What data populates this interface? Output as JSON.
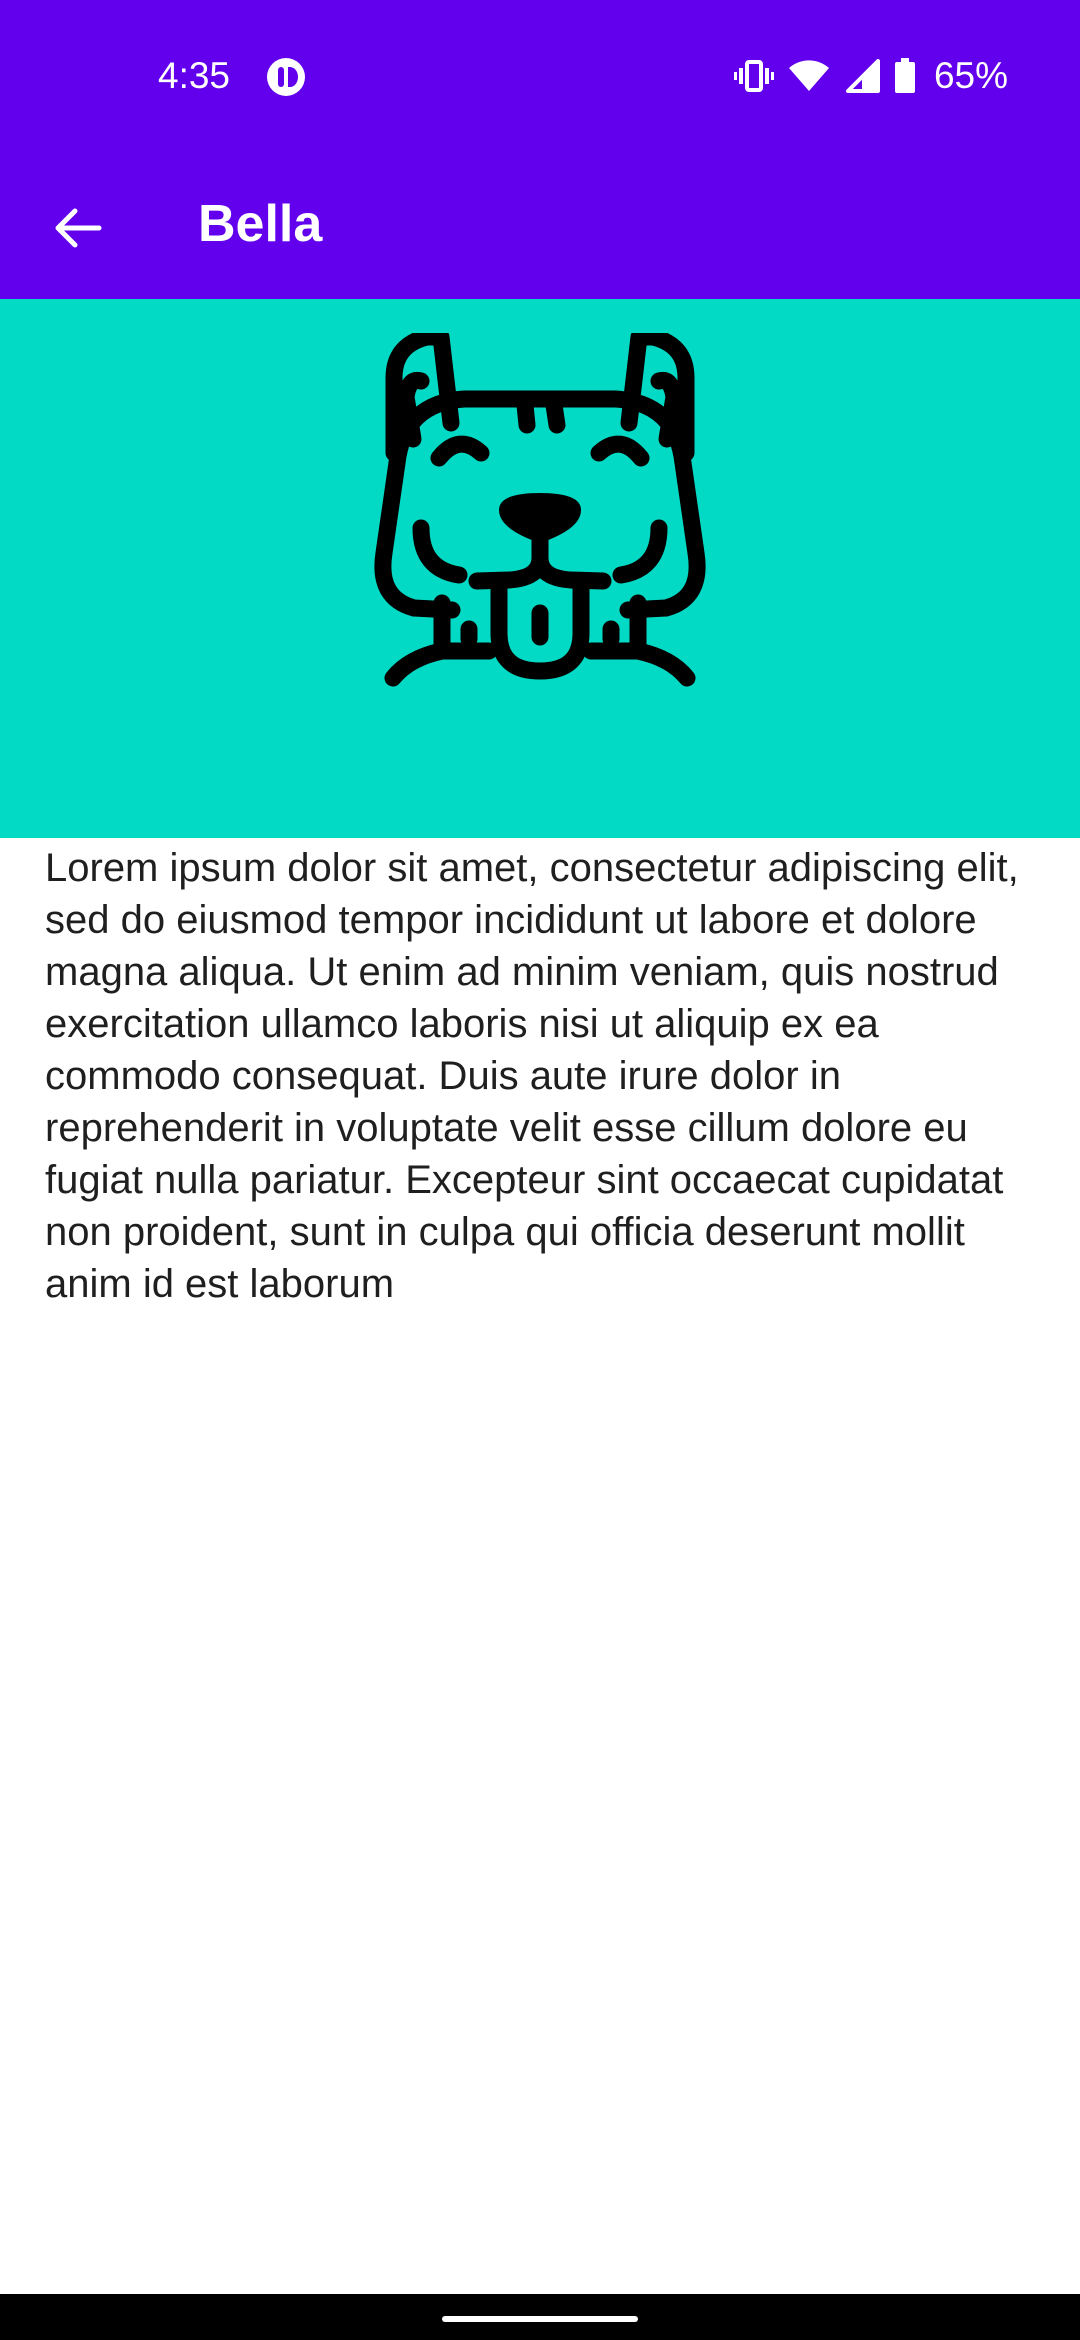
{
  "status_bar": {
    "time": "4:35",
    "battery_percent": "65%",
    "icons": [
      "app-notification-icon",
      "vibrate-icon",
      "wifi-icon",
      "signal-icon",
      "battery-icon"
    ]
  },
  "toolbar": {
    "back_icon": "arrow-back-icon",
    "title": "Bella"
  },
  "hero": {
    "image_icon": "dog-face-icon",
    "background_color": "#03dac5"
  },
  "content": {
    "description": "Lorem ipsum dolor sit amet, consectetur adipiscing elit, sed do eiusmod tempor incididunt ut labore et dolore magna aliqua. Ut enim ad minim veniam, quis nostrud exercitation ullamco laboris nisi ut aliquip ex ea commodo consequat. Duis aute irure dolor in reprehenderit in voluptate velit esse cillum dolore eu fugiat nulla pariatur. Excepteur sint occaecat cupidatat non proident, sunt in culpa qui officia deserunt mollit anim id est laborum"
  },
  "colors": {
    "primary": "#6200ee",
    "secondary": "#03dac5"
  }
}
